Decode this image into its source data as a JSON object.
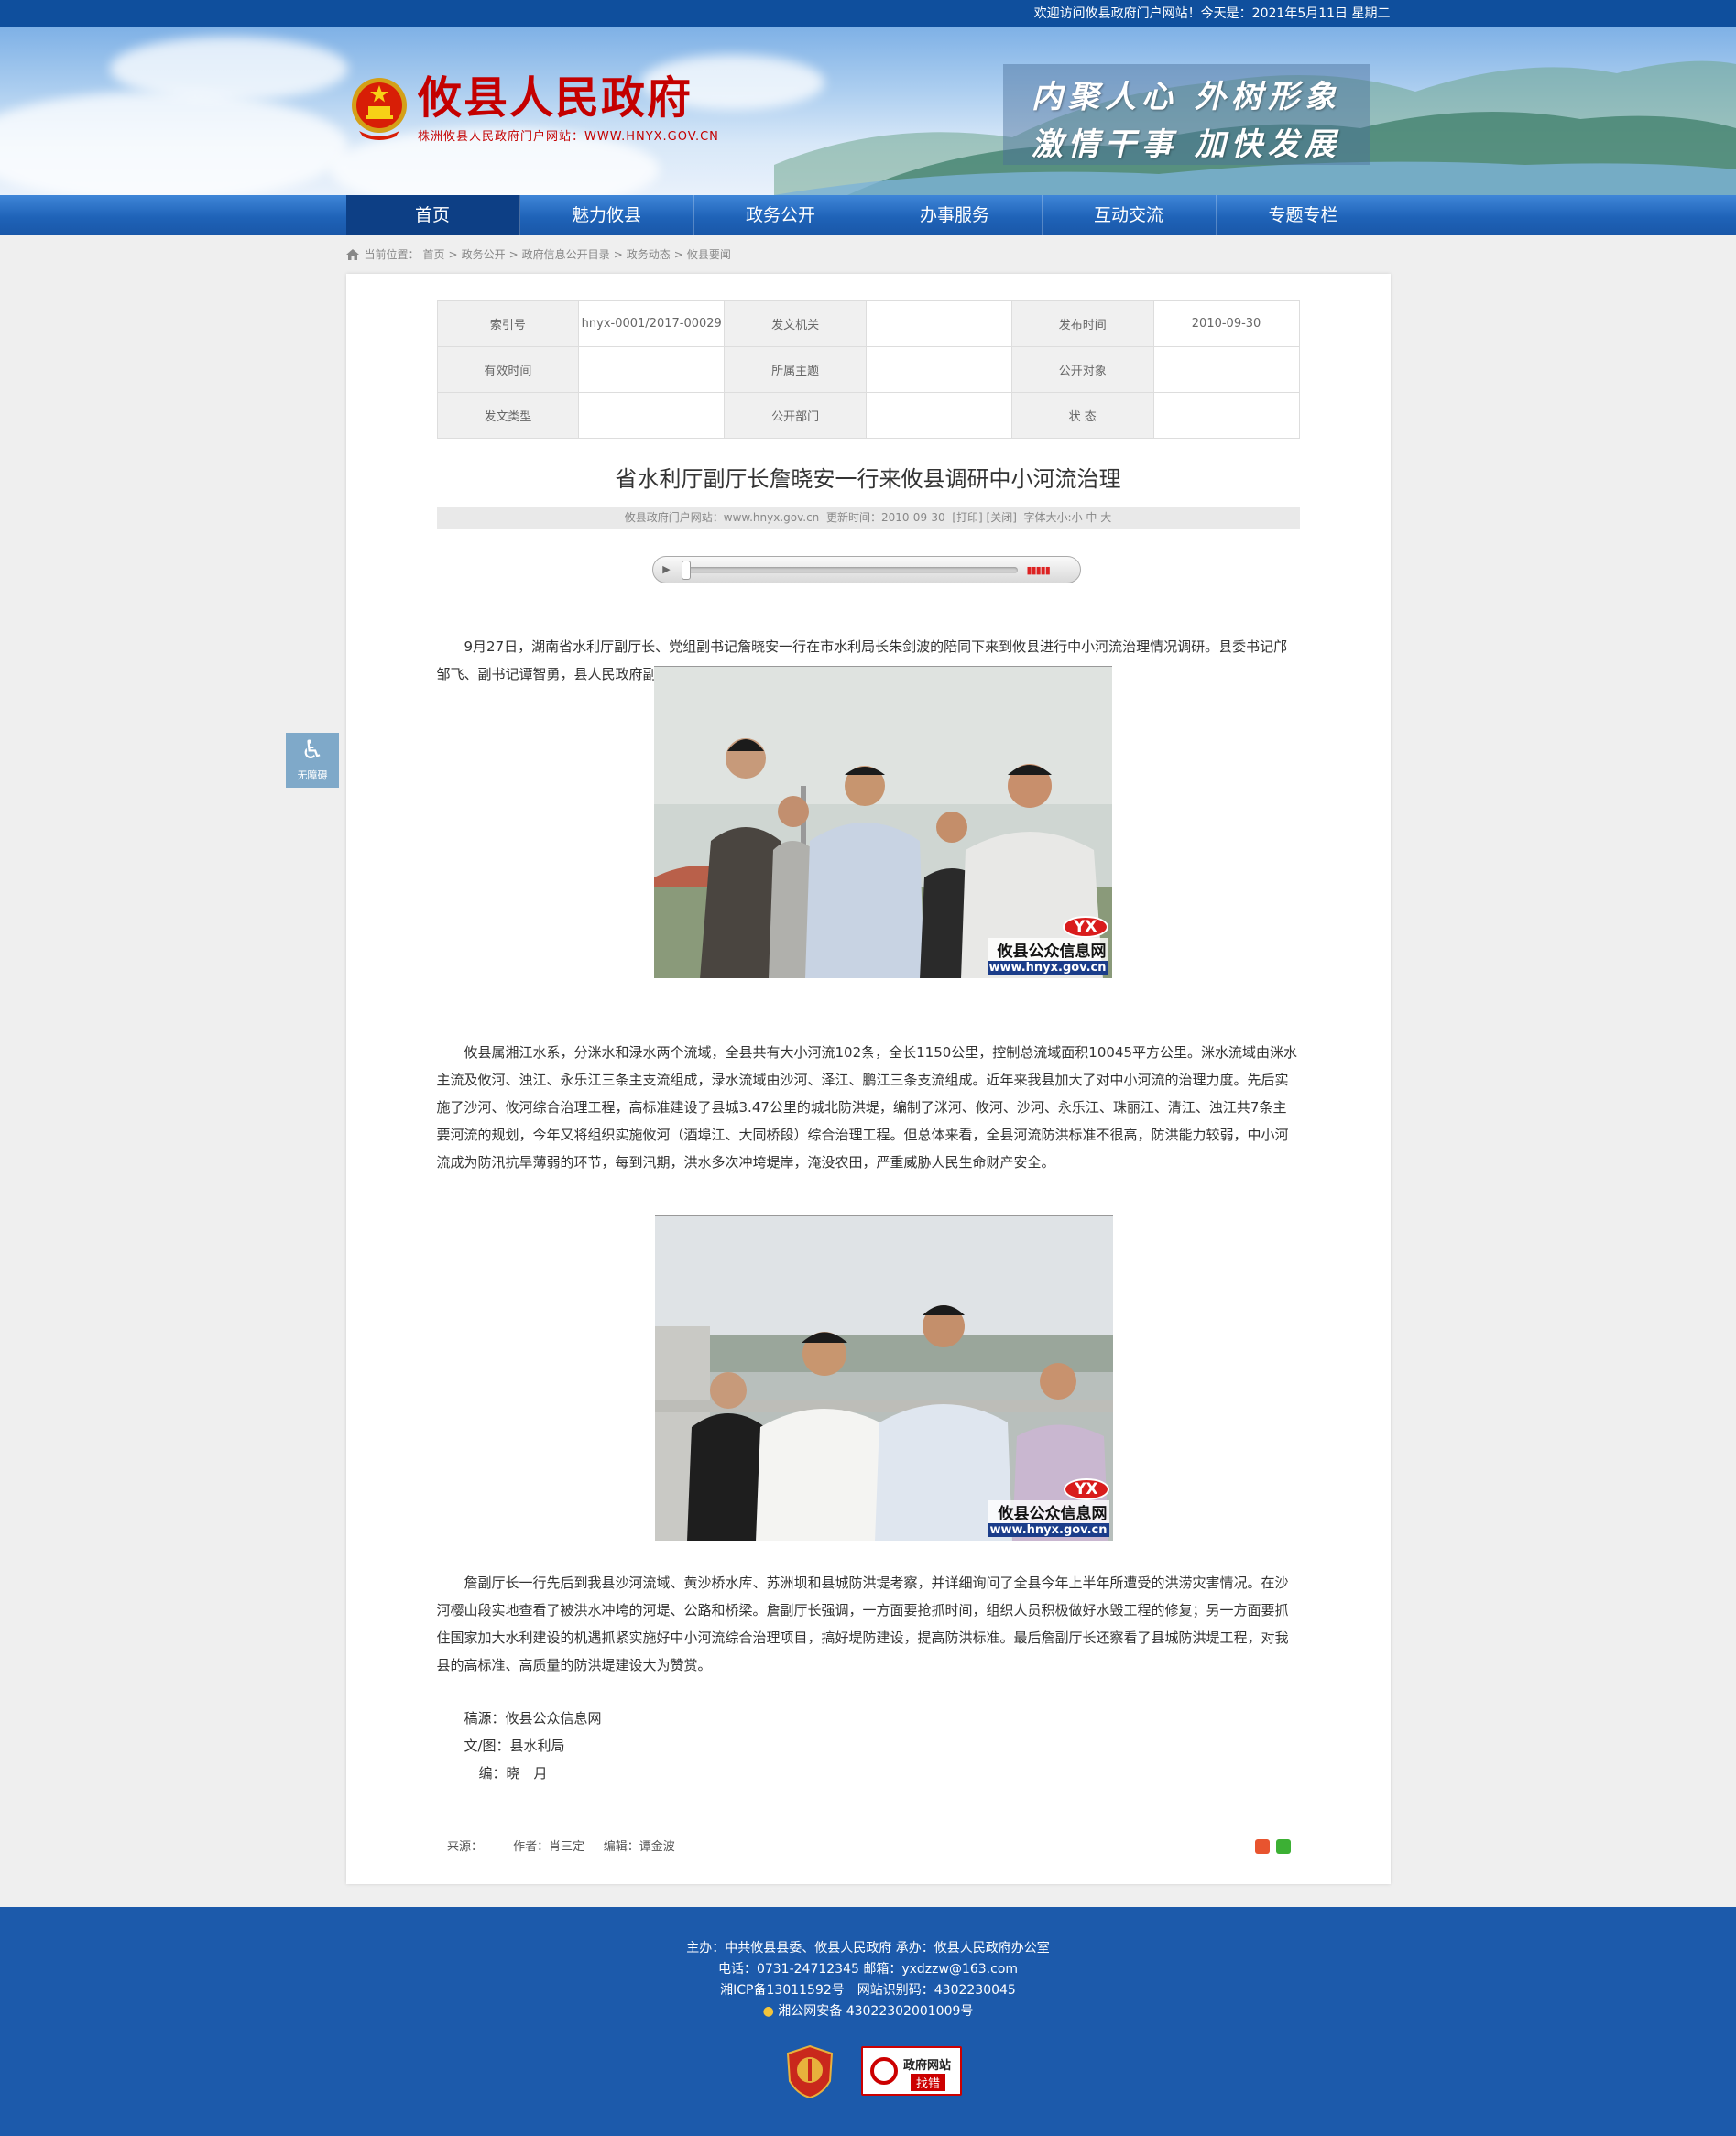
{
  "topbar": {
    "welcome": "欢迎访问攸县政府门户网站！今天是：2021年5月11日 星期二"
  },
  "header": {
    "title": "攸县人民政府",
    "subtitle": "株洲攸县人民政府门户网站：WWW.HNYX.GOV.CN",
    "slogan_line1": "内聚人心 外树形象",
    "slogan_line2": "激情干事 加快发展"
  },
  "nav": [
    {
      "label": "首页",
      "active": true
    },
    {
      "label": "魅力攸县"
    },
    {
      "label": "政务公开"
    },
    {
      "label": "办事服务"
    },
    {
      "label": "互动交流"
    },
    {
      "label": "专题专栏"
    }
  ],
  "breadcrumb": {
    "prefix": "当前位置：",
    "items": [
      "首页",
      "政务公开",
      "政府信息公开目录",
      "政务动态",
      "攸县要闻"
    ],
    "sep": ">"
  },
  "meta": {
    "index_label": "索引号",
    "index_value": "hnyx-0001/2017-00029",
    "issuer_label": "发文机关",
    "issuer_value": "",
    "pubdate_label": "发布时间",
    "pubdate_value": "2010-09-30",
    "valid_label": "有效时间",
    "valid_value": "",
    "topic_label": "所属主题",
    "topic_value": "",
    "audience_label": "公开对象",
    "audience_value": "",
    "doctype_label": "发文类型",
    "doctype_value": "",
    "dept_label": "公开部门",
    "dept_value": "",
    "status_label": "状 态",
    "status_value": ""
  },
  "article": {
    "title": "省水利厅副厅长詹晓安一行来攸县调研中小河流治理",
    "source_site": "攸县政府门户网站：www.hnyx.gov.cn",
    "updated": "更新时间：2010-09-30",
    "print": "[打印]",
    "close": "[关闭]",
    "fontsize": "字体大小:小 中 大",
    "para1": "9月27日，湖南省水利厅副厅长、党组副书记詹晓安一行在市水利局长朱剑波的陪同下来到攸县进行中小河流治理情况调研。县委书记邝邹飞、副书记谭智勇，县人民政府副县长文斌、副调研员张新华及县水利局主要负责人参加陪同调研。",
    "para2": "攸县属湘江水系，分洣水和渌水两个流域，全县共有大小河流102条，全长1150公里，控制总流域面积10045平方公里。洣水流域由洣水主流及攸河、浊江、永乐江三条主支流组成，渌水流域由沙河、泽江、鹏江三条支流组成。近年来我县加大了对中小河流的治理力度。先后实施了沙河、攸河综合治理工程，高标准建设了县城3.47公里的城北防洪堤，编制了洣河、攸河、沙河、永乐江、珠丽江、清江、浊江共7条主要河流的规划，今年又将组织实施攸河（酒埠江、大同桥段）综合治理工程。但总体来看，全县河流防洪标准不很高，防洪能力较弱，中小河流成为防汛抗旱薄弱的环节，每到汛期，洪水多次冲垮堤岸，淹没农田，严重威胁人民生命财产安全。",
    "para3": "詹副厅长一行先后到我县沙河流域、黄沙桥水库、苏洲坝和县城防洪堤考察，并详细询问了全县今年上半年所遭受的洪涝灾害情况。在沙河樱山段实地查看了被洪水冲垮的河堤、公路和桥梁。詹副厅长强调，一方面要抢抓时间，组织人员积极做好水毁工程的修复；另一方面要抓住国家加大水利建设的机遇抓紧实施好中小河流综合治理项目，搞好堤防建设，提高防洪标准。最后詹副厅长还察看了县城防洪堤工程，对我县的高标准、高质量的防洪堤建设大为赞赏。",
    "credit1": "稿源：攸县公众信息网",
    "credit2": "文/图：县水利局",
    "credit3": "编：晓　月",
    "footer_source": "来源：",
    "footer_author": "作者：肖三定",
    "footer_editor": "编辑：谭金波"
  },
  "watermark": {
    "badge": "YX",
    "name": "攸县公众信息网",
    "url": "www.hnyx.gov.cn"
  },
  "a11y": {
    "label": "无障碍"
  },
  "footer": {
    "line1": "主办：中共攸县县委、攸县人民政府 承办：攸县人民政府办公室",
    "line2": "电话：0731-24712345 邮箱：yxdzzw@163.com",
    "line3": "湘ICP备13011592号　网站识别码：4302230045",
    "line4": "湘公网安备 43022302001009号",
    "badge2_line1": "政府网站",
    "badge2_line2": "找错"
  },
  "colors": {
    "topbar": "#0f4f9d",
    "nav": "#1f63b8",
    "nav_active": "#0d3f85",
    "footer": "#1c5aab",
    "title_red": "#c40000"
  }
}
